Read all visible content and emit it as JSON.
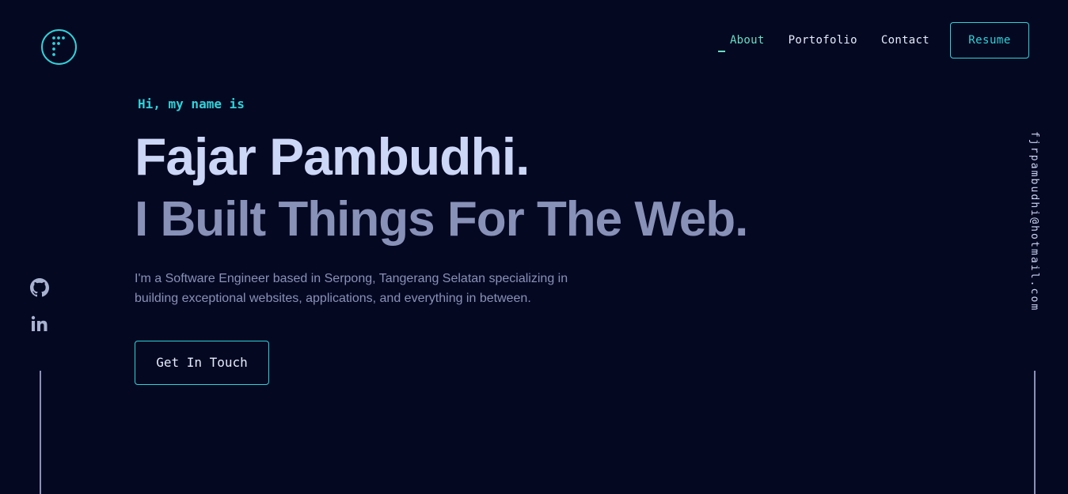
{
  "colors": {
    "background": "#050821",
    "accent": "#2dd4da",
    "active_link": "#64dfc4",
    "heading": "#ccd6f6",
    "muted": "#8891b8"
  },
  "logo": {
    "icon": "logo-f-icon"
  },
  "nav": {
    "links": [
      {
        "label": "About",
        "active": true
      },
      {
        "label": "Portofolio",
        "active": false
      },
      {
        "label": "Contact",
        "active": false
      }
    ],
    "resume_label": "Resume"
  },
  "hero": {
    "greeting": "Hi, my name is",
    "name": "Fajar Pambudhi.",
    "tagline": "I Built Things For The Web.",
    "description": "I'm a Software Engineer based in Serpong, Tangerang Selatan specializing in building exceptional websites, applications, and everything in between.",
    "cta_label": "Get In Touch"
  },
  "social": [
    {
      "icon": "github-icon"
    },
    {
      "icon": "linkedin-icon"
    }
  ],
  "email": "fjrpambudhi@hotmail.com"
}
